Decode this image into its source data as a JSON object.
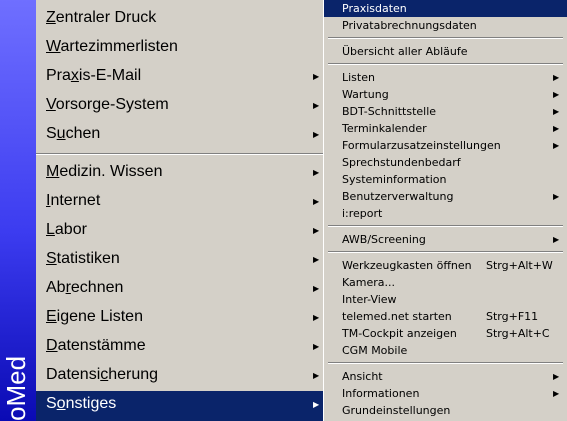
{
  "brand": {
    "text": "oMed"
  },
  "main_menu": {
    "zentraler_druck": {
      "pre": "",
      "key": "Z",
      "post": "entraler Druck"
    },
    "wartezimmerlisten": {
      "pre": "",
      "key": "W",
      "post": "artezimmerlisten"
    },
    "praxis_email": {
      "pre": "Pra",
      "key": "x",
      "post": "is-E-Mail"
    },
    "vorsorge_system": {
      "pre": "",
      "key": "V",
      "post": "orsorge-System"
    },
    "suchen": {
      "pre": "S",
      "key": "u",
      "post": "chen"
    },
    "medizin_wissen": {
      "pre": "",
      "key": "M",
      "post": "edizin. Wissen"
    },
    "internet": {
      "pre": "",
      "key": "I",
      "post": "nternet"
    },
    "labor": {
      "pre": "",
      "key": "L",
      "post": "abor"
    },
    "statistiken": {
      "pre": "",
      "key": "S",
      "post": "tatistiken"
    },
    "abrechnen": {
      "pre": "Ab",
      "key": "r",
      "post": "echnen"
    },
    "eigene_listen": {
      "pre": "",
      "key": "E",
      "post": "igene Listen"
    },
    "datenstaemme": {
      "pre": "",
      "key": "D",
      "post": "atenstämme"
    },
    "datensicherung": {
      "pre": "Datensi",
      "key": "c",
      "post": "herung"
    },
    "sonstiges": {
      "pre": "S",
      "key": "o",
      "post": "nstiges"
    }
  },
  "submenu": {
    "praxisdaten": "Praxisdaten",
    "privatabrechnungsdaten": "Privatabrechnungsdaten",
    "uebersicht_ablaeufe": "Übersicht aller Abläufe",
    "listen": "Listen",
    "wartung": "Wartung",
    "bdt_schnittstelle": "BDT-Schnittstelle",
    "terminkalender": "Terminkalender",
    "formularzusatzeinstellungen": "Formularzusatzeinstellungen",
    "sprechstundenbedarf": "Sprechstundenbedarf",
    "systeminformation": "Systeminformation",
    "benutzerverwaltung": "Benutzerverwaltung",
    "ireport": "i:report",
    "awb_screening": "AWB/Screening",
    "werkzeugkasten": "Werkzeugkasten öffnen",
    "werkzeugkasten_shortcut": "Strg+Alt+W",
    "kamera": "Kamera...",
    "inter_view": "Inter-View",
    "telemed": "telemed.net starten",
    "telemed_shortcut": "Strg+F11",
    "tm_cockpit": "TM-Cockpit anzeigen",
    "tm_cockpit_shortcut": "Strg+Alt+C",
    "cgm_mobile": "CGM Mobile",
    "ansicht": "Ansicht",
    "informationen": "Informationen",
    "grundeinstellungen": "Grundeinstellungen"
  },
  "icons": {
    "submenu_arrow": "▶"
  }
}
